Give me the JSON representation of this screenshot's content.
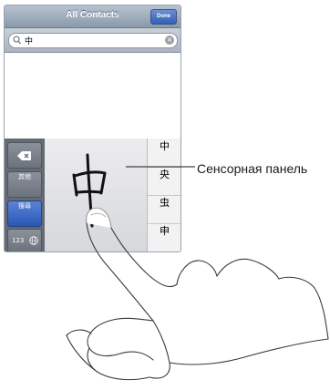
{
  "navbar": {
    "title": "All Contacts",
    "done_label": "Done"
  },
  "search": {
    "value": "中"
  },
  "keyboard": {
    "side_keys": {
      "other": "其他",
      "search": "搜尋",
      "numbers": "123"
    },
    "candidates": [
      "中",
      "央",
      "虫",
      "申"
    ],
    "handwritten_glyph": "中"
  },
  "callout": {
    "label": "Сенсорная панель"
  }
}
